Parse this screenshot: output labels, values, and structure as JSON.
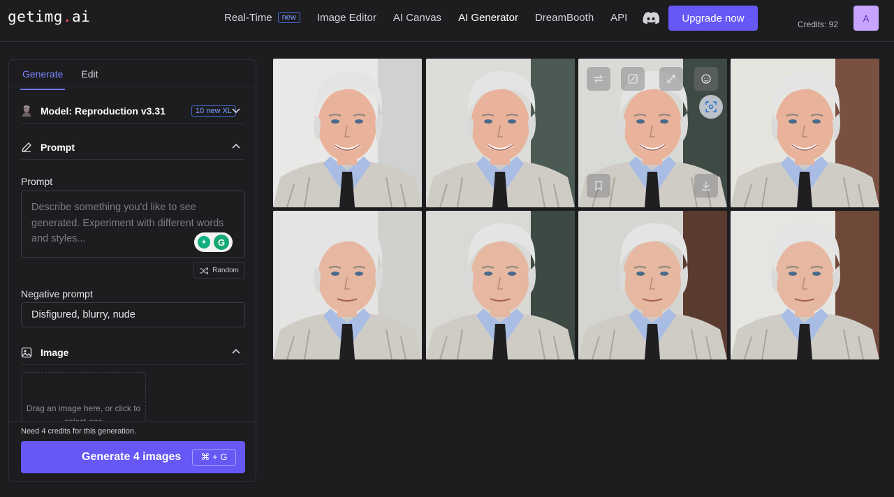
{
  "app": {
    "logo_main": "getimg",
    "logo_dot": ".",
    "logo_tld": "ai"
  },
  "nav": {
    "items": [
      {
        "label": "Real-Time",
        "badge": "new"
      },
      {
        "label": "Image Editor"
      },
      {
        "label": "AI Canvas"
      },
      {
        "label": "AI Generator",
        "active": true
      },
      {
        "label": "DreamBooth"
      },
      {
        "label": "API"
      }
    ],
    "discord_icon": "discord-icon",
    "upgrade_label": "Upgrade now",
    "credits_text": "Credits: 92",
    "avatar_initial": "A"
  },
  "sidebar": {
    "tabs": [
      {
        "label": "Generate",
        "active": true
      },
      {
        "label": "Edit"
      }
    ],
    "model": {
      "label": "Model: Reproduction v3.31",
      "badge": "10 new XL"
    },
    "prompt_section": {
      "title": "Prompt",
      "field_label": "Prompt",
      "placeholder": "Describe something you'd like to see generated. Experiment with different words and styles...",
      "random_label": "Random"
    },
    "negative": {
      "label": "Negative prompt",
      "value": "Disfigured, blurry, nude"
    },
    "image_section": {
      "title": "Image",
      "drop_text": "Drag an image here, or click to select one"
    },
    "footer": {
      "need_text": "Need 4 credits for this generation.",
      "generate_label": "Generate 4 images",
      "shortcut": "⌘ + G"
    }
  },
  "colors": {
    "accent": "#6558f5",
    "background": "#1d1d20",
    "badge_blue": "#7da1ff"
  },
  "gallery": {
    "images": [
      {
        "name": "generated-image-1",
        "age": "older"
      },
      {
        "name": "generated-image-2",
        "age": "older"
      },
      {
        "name": "generated-image-3",
        "age": "older",
        "hovered": true
      },
      {
        "name": "generated-image-4",
        "age": "older"
      },
      {
        "name": "generated-image-5",
        "age": "younger"
      },
      {
        "name": "generated-image-6",
        "age": "younger"
      },
      {
        "name": "generated-image-7",
        "age": "younger"
      },
      {
        "name": "generated-image-8",
        "age": "younger"
      }
    ]
  }
}
